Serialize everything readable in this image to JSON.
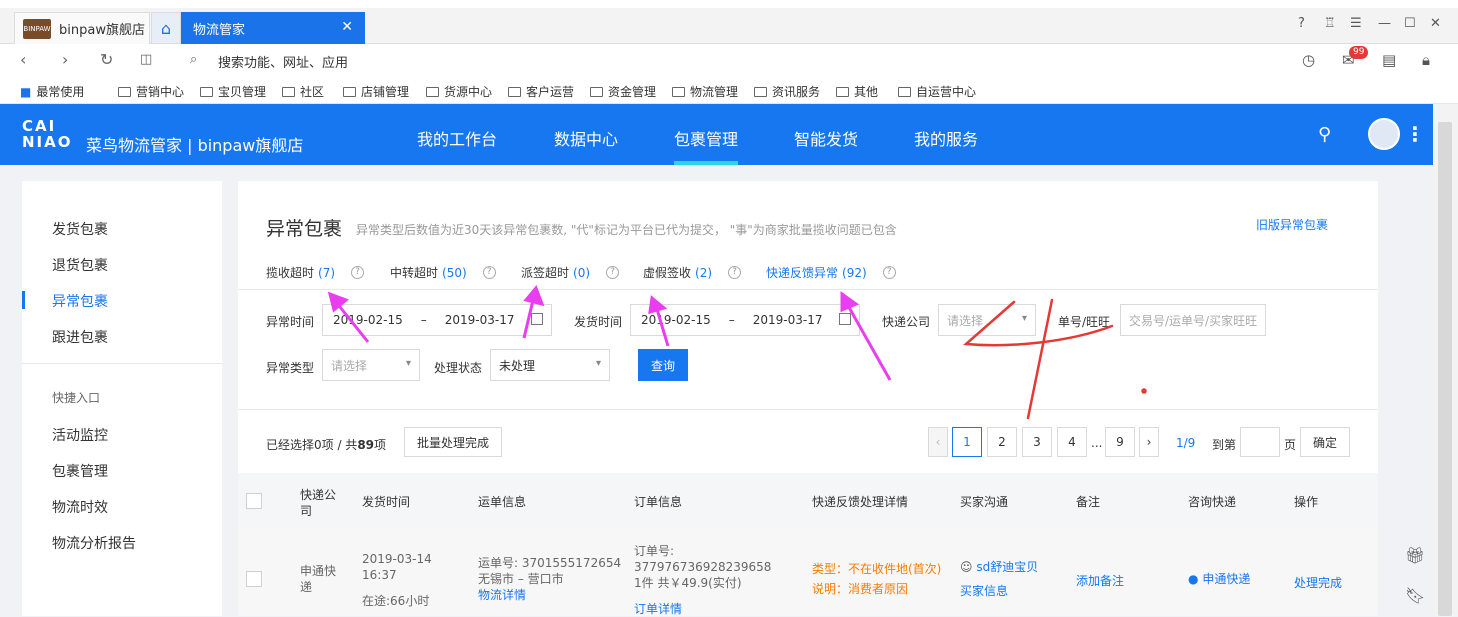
{
  "browser": {
    "tabs": [
      {
        "label": "binpaw旗舰店",
        "favicon": "shop-logo"
      },
      {
        "label": "物流管家",
        "active": true
      }
    ],
    "address_placeholder": "搜索功能、网址、应用",
    "notif_badge": "99",
    "bookmarks": [
      "最常使用",
      "营销中心",
      "宝贝管理",
      "社区",
      "店铺管理",
      "货源中心",
      "客户运营",
      "资金管理",
      "物流管理",
      "资讯服务",
      "其他",
      "自运营中心"
    ]
  },
  "header": {
    "logo_line1": "CAI",
    "logo_line2": "NIAO",
    "brand": "菜鸟物流管家 | binpaw旗舰店",
    "nav": [
      "我的工作台",
      "数据中心",
      "包裹管理",
      "智能发货",
      "我的服务"
    ],
    "active_nav": "包裹管理"
  },
  "sidebar": {
    "items": [
      "发货包裹",
      "退货包裹",
      "异常包裹",
      "跟进包裹"
    ],
    "active": "异常包裹",
    "group_title": "快捷入口",
    "quick": [
      "活动监控",
      "包裹管理",
      "物流时效",
      "物流分析报告"
    ]
  },
  "page": {
    "title": "异常包裹",
    "description": "异常类型后数值为近30天该异常包裹数, \"代\"标记为平台已代为提交， \"事\"为商家批量揽收问题已包含",
    "old_link": "旧版异常包裹",
    "tabs": [
      {
        "label": "揽收超时",
        "count": "(7)"
      },
      {
        "label": "中转超时",
        "count": "(50)"
      },
      {
        "label": "派签超时",
        "count": "(0)"
      },
      {
        "label": "虚假签收",
        "count": "(2)"
      },
      {
        "label": "快递反馈异常",
        "count": "(92)"
      }
    ]
  },
  "filters": {
    "abnormal_time_label": "异常时间",
    "abnormal_start": "2019-02-15",
    "abnormal_end": "2019-03-17",
    "ship_time_label": "发货时间",
    "ship_start": "2019-02-15",
    "ship_end": "2019-03-17",
    "dash": "–",
    "courier_label": "快递公司",
    "courier_placeholder": "请选择",
    "order_label": "单号/旺旺",
    "order_placeholder": "交易号/运单号/买家旺旺",
    "type_label": "异常类型",
    "type_placeholder": "请选择",
    "status_label": "处理状态",
    "status_value": "未处理",
    "query_button": "查询"
  },
  "list_bar": {
    "selected_prefix": "已经选择0项 / 共",
    "total": "89",
    "selected_suffix": "项",
    "batch_button": "批量处理完成",
    "pages": [
      "1",
      "2",
      "3",
      "4",
      "...",
      "9"
    ],
    "page_info": "1/9",
    "goto_label": "到第",
    "page_unit": "页",
    "confirm": "确定",
    "prev": "‹",
    "next": "›"
  },
  "table": {
    "headers": [
      "快递公司",
      "发货时间",
      "运单信息",
      "订单信息",
      "快递反馈处理详情",
      "买家沟通",
      "备注",
      "咨询快递",
      "操作"
    ],
    "row": {
      "courier": "申通快递",
      "ship_time": "2019-03-14 16:37",
      "transit": "在途:66小时",
      "waybill": "运单号: 3701555172654",
      "route": "无锡市 – 营口市",
      "waybill_link": "物流详情",
      "order_label": "订单号:",
      "order_no": "377976736928239658",
      "order_sum": "1件 共￥49.9(实付)",
      "order_link": "订单详情",
      "fb_type": "类型：不在收件地(首次)",
      "fb_desc": "说明：消费者原因",
      "buyer": "sd舒迪宝贝",
      "buyer_link": "买家信息",
      "remark": "添加备注",
      "consult": "申通快递",
      "action": "处理完成"
    }
  },
  "annotation": {
    "handwritten_digit": "4"
  }
}
